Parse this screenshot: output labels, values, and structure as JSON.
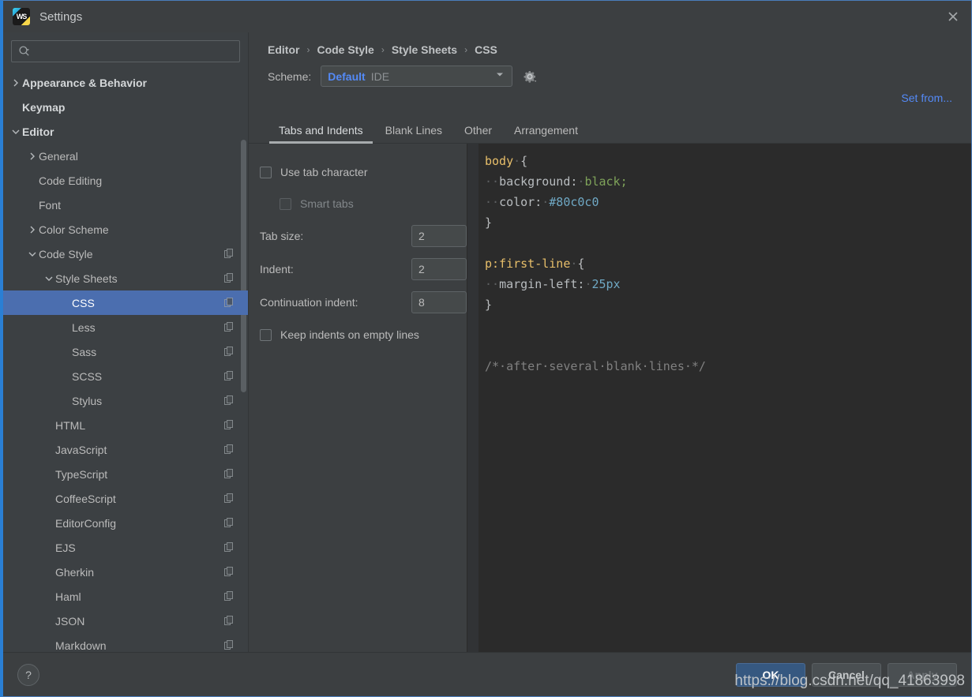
{
  "window": {
    "title": "Settings",
    "app_icon": "webstorm-icon",
    "close_icon": "close-icon"
  },
  "sidebar": {
    "search": {
      "value": "",
      "placeholder": "",
      "icon": "search-icon",
      "dropdown_icon": "chevron-down-icon"
    },
    "items": [
      {
        "label": "Appearance & Behavior",
        "indent": 0,
        "twisty": "collapsed",
        "bold": true,
        "copy": false,
        "selected": false
      },
      {
        "label": "Keymap",
        "indent": 0,
        "twisty": "none",
        "bold": true,
        "copy": false,
        "selected": false
      },
      {
        "label": "Editor",
        "indent": 0,
        "twisty": "expanded",
        "bold": true,
        "copy": false,
        "selected": false
      },
      {
        "label": "General",
        "indent": 1,
        "twisty": "collapsed",
        "bold": false,
        "copy": false,
        "selected": false
      },
      {
        "label": "Code Editing",
        "indent": 1,
        "twisty": "none",
        "bold": false,
        "copy": false,
        "selected": false
      },
      {
        "label": "Font",
        "indent": 1,
        "twisty": "none",
        "bold": false,
        "copy": false,
        "selected": false
      },
      {
        "label": "Color Scheme",
        "indent": 1,
        "twisty": "collapsed",
        "bold": false,
        "copy": false,
        "selected": false
      },
      {
        "label": "Code Style",
        "indent": 1,
        "twisty": "expanded",
        "bold": false,
        "copy": true,
        "selected": false
      },
      {
        "label": "Style Sheets",
        "indent": 2,
        "twisty": "expanded",
        "bold": false,
        "copy": true,
        "selected": false
      },
      {
        "label": "CSS",
        "indent": 3,
        "twisty": "none",
        "bold": false,
        "copy": true,
        "selected": true
      },
      {
        "label": "Less",
        "indent": 3,
        "twisty": "none",
        "bold": false,
        "copy": true,
        "selected": false
      },
      {
        "label": "Sass",
        "indent": 3,
        "twisty": "none",
        "bold": false,
        "copy": true,
        "selected": false
      },
      {
        "label": "SCSS",
        "indent": 3,
        "twisty": "none",
        "bold": false,
        "copy": true,
        "selected": false
      },
      {
        "label": "Stylus",
        "indent": 3,
        "twisty": "none",
        "bold": false,
        "copy": true,
        "selected": false
      },
      {
        "label": "HTML",
        "indent": 2,
        "twisty": "none",
        "bold": false,
        "copy": true,
        "selected": false
      },
      {
        "label": "JavaScript",
        "indent": 2,
        "twisty": "none",
        "bold": false,
        "copy": true,
        "selected": false
      },
      {
        "label": "TypeScript",
        "indent": 2,
        "twisty": "none",
        "bold": false,
        "copy": true,
        "selected": false
      },
      {
        "label": "CoffeeScript",
        "indent": 2,
        "twisty": "none",
        "bold": false,
        "copy": true,
        "selected": false
      },
      {
        "label": "EditorConfig",
        "indent": 2,
        "twisty": "none",
        "bold": false,
        "copy": true,
        "selected": false
      },
      {
        "label": "EJS",
        "indent": 2,
        "twisty": "none",
        "bold": false,
        "copy": true,
        "selected": false
      },
      {
        "label": "Gherkin",
        "indent": 2,
        "twisty": "none",
        "bold": false,
        "copy": true,
        "selected": false
      },
      {
        "label": "Haml",
        "indent": 2,
        "twisty": "none",
        "bold": false,
        "copy": true,
        "selected": false
      },
      {
        "label": "JSON",
        "indent": 2,
        "twisty": "none",
        "bold": false,
        "copy": true,
        "selected": false
      },
      {
        "label": "Markdown",
        "indent": 2,
        "twisty": "none",
        "bold": false,
        "copy": true,
        "selected": false
      }
    ]
  },
  "panel": {
    "breadcrumb": [
      "Editor",
      "Code Style",
      "Style Sheets",
      "CSS"
    ],
    "breadcrumb_separator": "›",
    "scheme": {
      "label": "Scheme:",
      "value_main": "Default",
      "value_sub": "IDE",
      "caret_icon": "chevron-down-icon",
      "gear_icon": "gear-icon"
    },
    "set_from_link": "Set from...",
    "tabs": [
      {
        "label": "Tabs and Indents",
        "active": true
      },
      {
        "label": "Blank Lines",
        "active": false
      },
      {
        "label": "Other",
        "active": false
      },
      {
        "label": "Arrangement",
        "active": false
      }
    ],
    "form": {
      "use_tab_character": {
        "label": "Use tab character",
        "checked": false,
        "disabled": false
      },
      "smart_tabs": {
        "label": "Smart tabs",
        "checked": false,
        "disabled": true
      },
      "tab_size": {
        "label": "Tab size:",
        "value": "2"
      },
      "indent": {
        "label": "Indent:",
        "value": "2"
      },
      "continuation_indent": {
        "label": "Continuation indent:",
        "value": "8"
      },
      "keep_indents": {
        "label": "Keep indents on empty lines",
        "checked": false,
        "disabled": false
      }
    },
    "preview": {
      "lines": [
        [
          {
            "t": "body",
            "c": "sel"
          },
          {
            "t": "·",
            "c": "dot"
          },
          {
            "t": "{",
            "c": "punc"
          }
        ],
        [
          {
            "t": "··",
            "c": "dot"
          },
          {
            "t": "background:",
            "c": "prop"
          },
          {
            "t": "·",
            "c": "dot"
          },
          {
            "t": "black",
            "c": "val-kw"
          },
          {
            "t": ";",
            "c": "val-kw"
          }
        ],
        [
          {
            "t": "··",
            "c": "dot"
          },
          {
            "t": "color:",
            "c": "prop"
          },
          {
            "t": "·",
            "c": "dot"
          },
          {
            "t": "#80c0c0",
            "c": "val-num"
          }
        ],
        [
          {
            "t": "}",
            "c": "punc"
          }
        ],
        [],
        [
          {
            "t": "p:first-line",
            "c": "sel"
          },
          {
            "t": "·",
            "c": "dot"
          },
          {
            "t": "{",
            "c": "punc"
          }
        ],
        [
          {
            "t": "··",
            "c": "dot"
          },
          {
            "t": "margin-left:",
            "c": "prop"
          },
          {
            "t": "·",
            "c": "dot"
          },
          {
            "t": "25px",
            "c": "val-num"
          }
        ],
        [
          {
            "t": "}",
            "c": "punc"
          }
        ],
        [],
        [],
        [
          {
            "t": "/*·after·several·blank·lines·*/",
            "c": "comment"
          }
        ]
      ]
    }
  },
  "footer": {
    "help_label": "?",
    "ok_label": "OK",
    "cancel_label": "Cancel",
    "apply_label": "Apply",
    "apply_disabled": true
  },
  "watermark": "https://blog.csdn.net/qq_41863998",
  "colors": {
    "accent_blue": "#4b6eaf",
    "link_blue": "#548af7",
    "primary_button": "#365880",
    "panel_bg": "#3c3f41",
    "sidebar_bg": "#3c4043",
    "editor_bg": "#2b2b2b"
  }
}
